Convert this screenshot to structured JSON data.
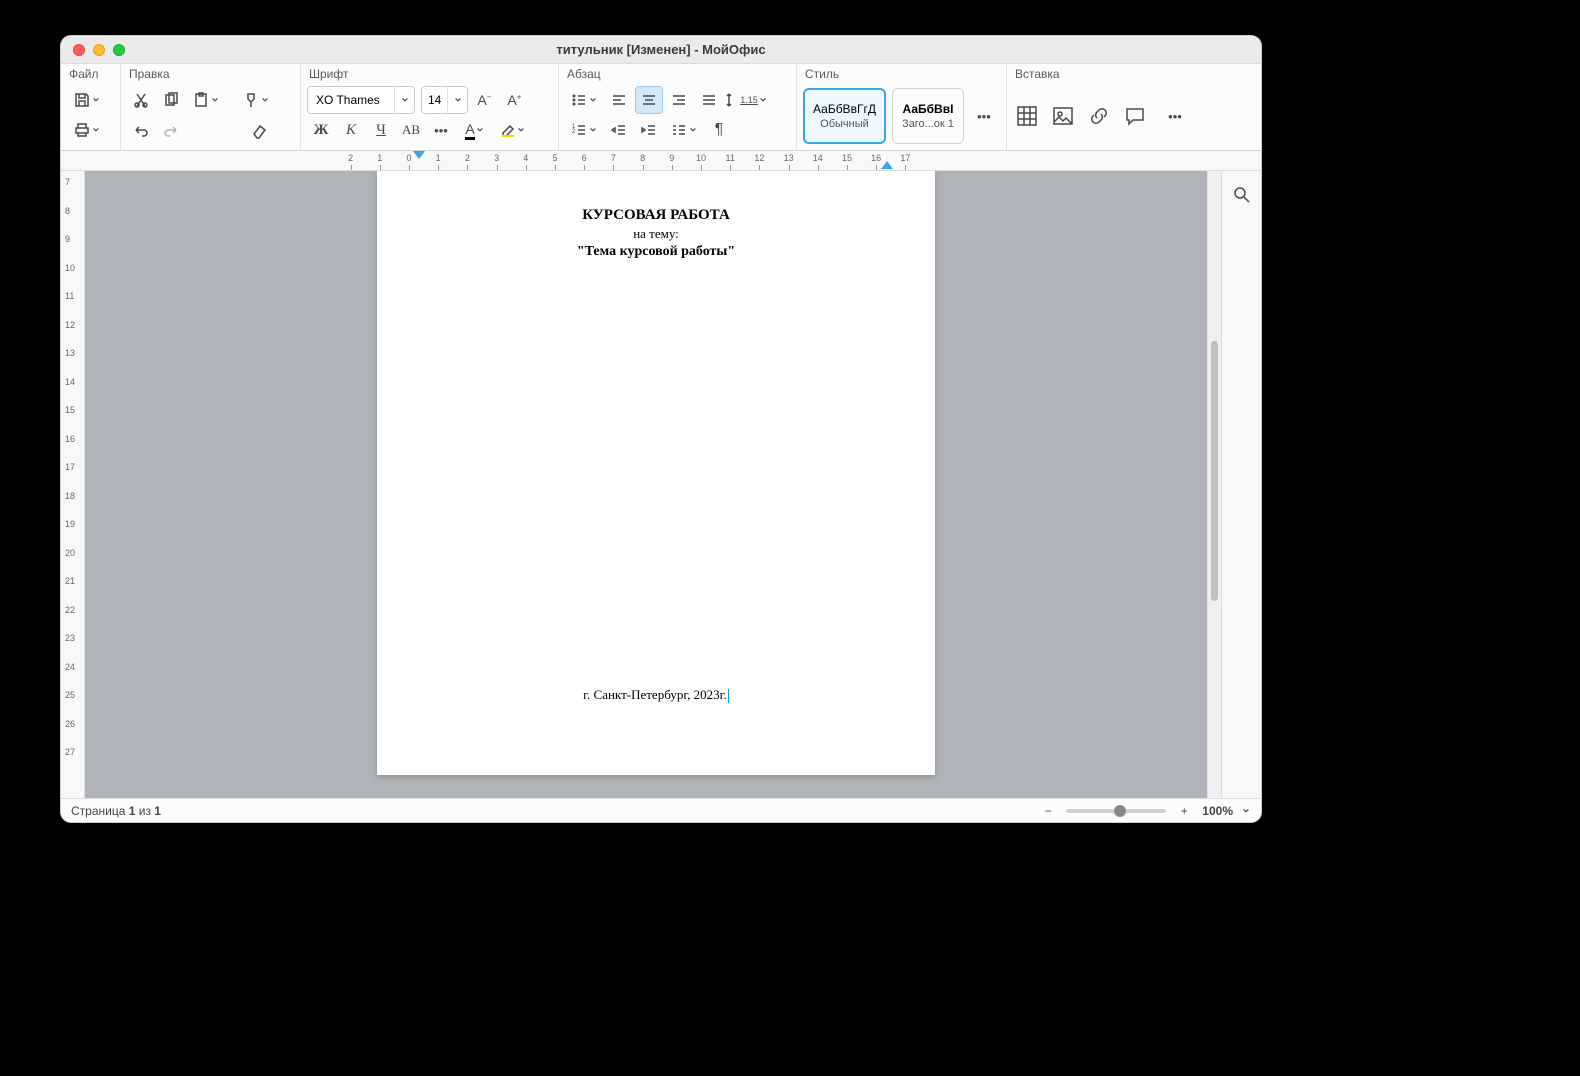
{
  "window": {
    "title": "титульник [Изменен] - МойОфис"
  },
  "ribbon": {
    "file": {
      "label": "Файл"
    },
    "edit": {
      "label": "Правка"
    },
    "font": {
      "label": "Шрифт",
      "family": "XO Thames",
      "size": "14"
    },
    "paragraph": {
      "label": "Абзац",
      "line_spacing": "1.15"
    },
    "style": {
      "label": "Стиль",
      "items": [
        {
          "preview": "АаБбВвГгД",
          "name": "Обычный"
        },
        {
          "preview": "АаБбВвІ",
          "name": "Заго...ок 1"
        }
      ]
    },
    "insert": {
      "label": "Вставка"
    }
  },
  "ruler_h": [
    -2,
    -1,
    0,
    1,
    2,
    3,
    4,
    5,
    6,
    7,
    8,
    9,
    10,
    11,
    12,
    13,
    14,
    15,
    16,
    17
  ],
  "ruler_v": [
    7,
    8,
    9,
    10,
    11,
    12,
    13,
    14,
    15,
    16,
    17,
    18,
    19,
    20,
    21,
    22,
    23,
    24,
    25,
    26,
    27
  ],
  "document": {
    "heading": "КУРСОВАЯ РАБОТА",
    "sub": "на тему:",
    "topic": "\"Тема курсовой работы\"",
    "footer": "г. Санкт-Петербург, 2023г."
  },
  "status": {
    "page_label_prefix": "Страница ",
    "page_current": "1",
    "page_of": " из ",
    "page_total": "1",
    "zoom": "100%"
  }
}
